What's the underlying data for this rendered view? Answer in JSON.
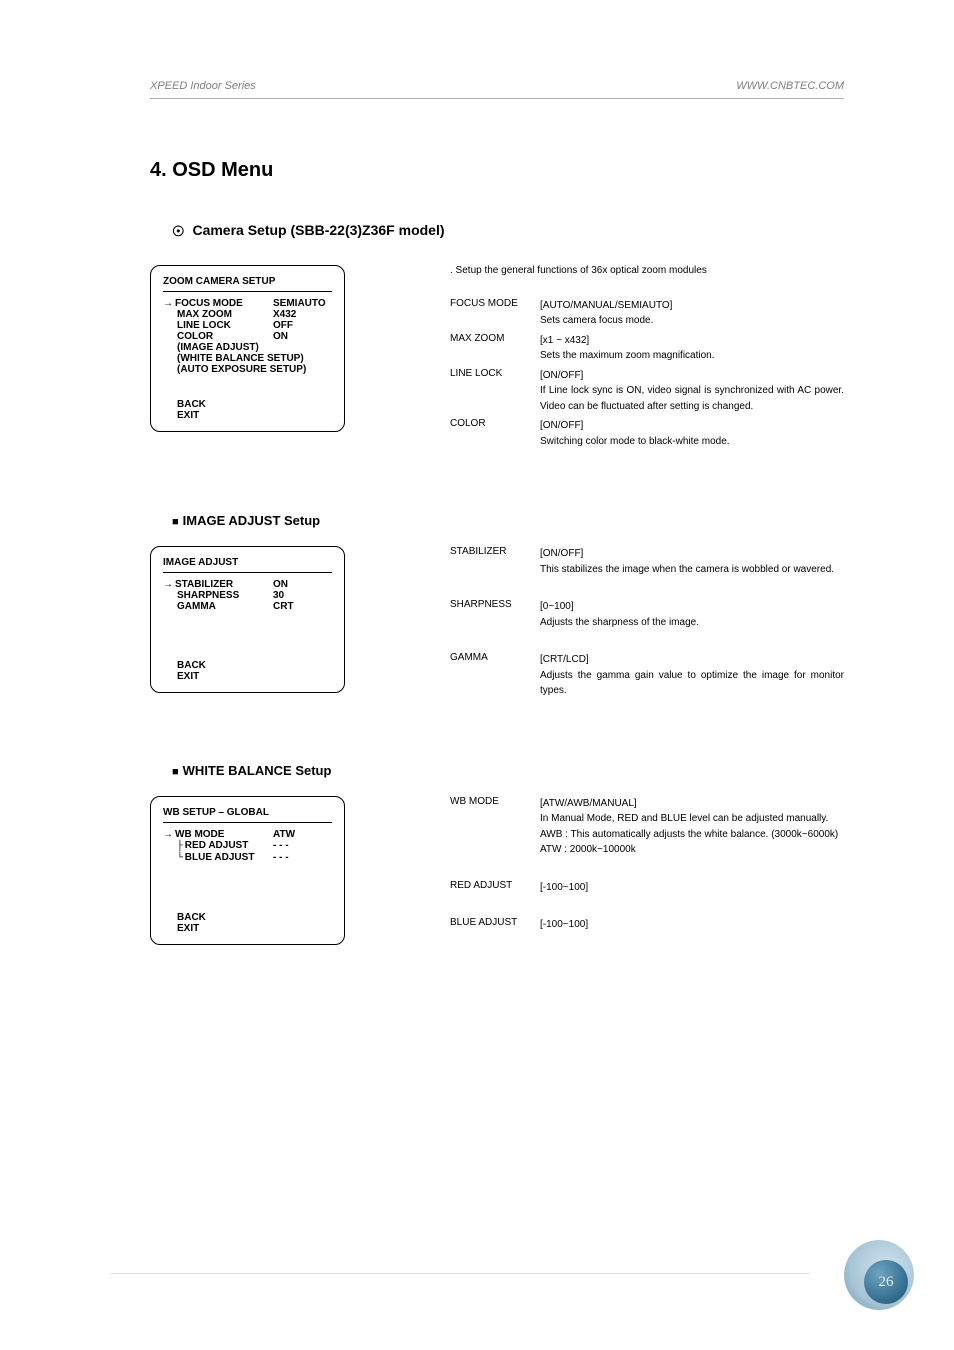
{
  "header": {
    "left": "XPEED Indoor Series",
    "right": "WWW.CNBTEC.COM"
  },
  "title": "4. OSD Menu",
  "subsection": "Camera Setup (SBB-22(3)Z36F model)",
  "zoom_box": {
    "title": "ZOOM CAMERA SETUP",
    "rows": [
      {
        "label": "FOCUS MODE",
        "value": "SEMIAUTO",
        "arrow": true
      },
      {
        "label": "MAX  ZOOM",
        "value": "X432"
      },
      {
        "label": "LINE LOCK",
        "value": "OFF"
      },
      {
        "label": "COLOR",
        "value": "ON"
      },
      {
        "label": "(IMAGE ADJUST)",
        "value": ""
      },
      {
        "label": "(WHITE BALANCE SETUP)",
        "value": ""
      },
      {
        "label": "(AUTO EXPOSURE SETUP)",
        "value": ""
      }
    ],
    "back": "BACK",
    "exit": "EXIT"
  },
  "zoom_desc": {
    "lead": ". Setup the general functions of 36x optical zoom modules",
    "items": [
      {
        "k": "FOCUS MODE",
        "range": "[AUTO/MANUAL/SEMIAUTO]",
        "text": "Sets camera focus mode."
      },
      {
        "k": "MAX ZOOM",
        "range": "[x1 ~ x432]",
        "text": "Sets the maximum zoom magnification."
      },
      {
        "k": "LINE LOCK",
        "range": "[ON/OFF]",
        "text": "If Line lock sync is ON, video signal is synchronized with AC power. Video can be fluctuated after setting is changed."
      },
      {
        "k": "COLOR",
        "range": "[ON/OFF]",
        "text": "Switching color mode to black-white mode."
      }
    ]
  },
  "image_heading": "IMAGE ADJUST Setup",
  "image_box": {
    "title": "IMAGE ADJUST",
    "rows": [
      {
        "label": "STABILIZER",
        "value": "ON",
        "arrow": true
      },
      {
        "label": "SHARPNESS",
        "value": "30"
      },
      {
        "label": "GAMMA",
        "value": "CRT"
      }
    ],
    "back": "BACK",
    "exit": "EXIT"
  },
  "image_desc": {
    "items": [
      {
        "k": "STABILIZER",
        "range": "[ON/OFF]",
        "text": "This stabilizes the image when the camera is wobbled or wavered."
      },
      {
        "k": "SHARPNESS",
        "range": "[0~100]",
        "text": "Adjusts the sharpness of the image."
      },
      {
        "k": "GAMMA",
        "range": "[CRT/LCD]",
        "text": "Adjusts the gamma gain value to optimize the image for monitor types."
      }
    ]
  },
  "wb_heading": "WHITE BALANCE Setup",
  "wb_box": {
    "title": "WB SETUP – GLOBAL",
    "rows": [
      {
        "label": "WB MODE",
        "value": "ATW",
        "arrow": true,
        "tree": ""
      },
      {
        "label": "RED ADJUST",
        "value": "- - -",
        "tree": "├"
      },
      {
        "label": "BLUE ADJUST",
        "value": "- - -",
        "tree": "└"
      }
    ],
    "back": "BACK",
    "exit": "EXIT"
  },
  "wb_desc": {
    "items": [
      {
        "k": "WB MODE",
        "range": "[ATW/AWB/MANUAL]",
        "text": "In Manual Mode, RED and BLUE level can be adjusted manually.\nAWB : This automatically adjusts the white balance. (3000k~6000k)\nATW : 2000k~10000k"
      },
      {
        "k": "RED ADJUST",
        "range": "[-100~100]",
        "text": ""
      },
      {
        "k": "BLUE ADJUST",
        "range": "[-100~100]",
        "text": ""
      }
    ]
  },
  "page_number": "26"
}
